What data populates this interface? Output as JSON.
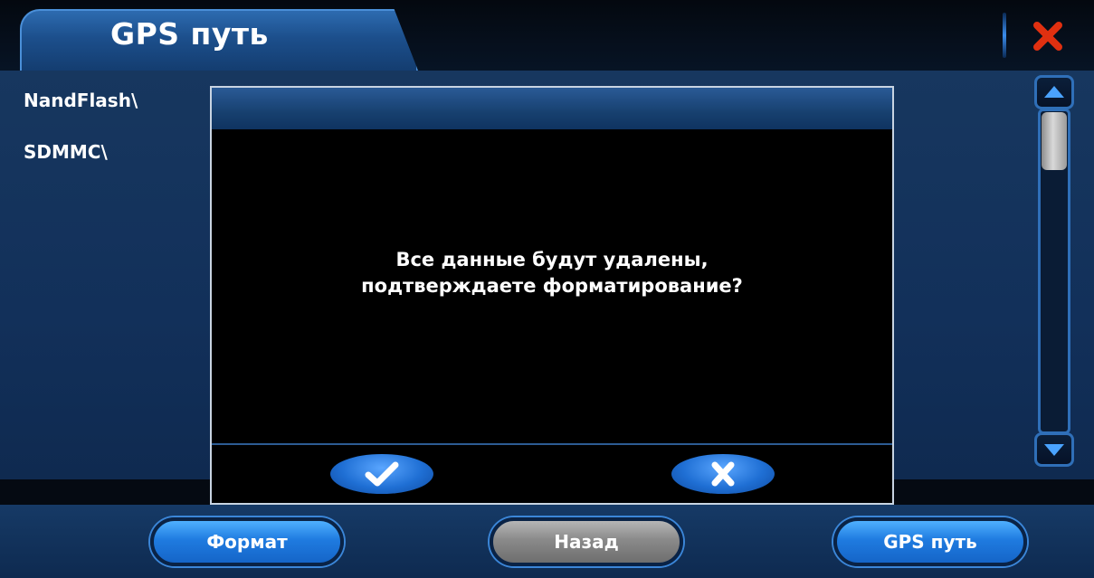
{
  "header": {
    "title": "GPS путь",
    "close_icon": "close-icon",
    "close_color": "#e03010"
  },
  "storage_list": {
    "items": [
      {
        "label": "NandFlash\\"
      },
      {
        "label": "SDMMC\\"
      }
    ]
  },
  "scrollbar": {
    "up_icon": "triangle-up-icon",
    "down_icon": "triangle-down-icon"
  },
  "dialog": {
    "message_line1": "Все данные будут удалены,",
    "message_line2": "подтверждаете форматирование?",
    "confirm_icon": "checkmark-icon",
    "cancel_icon": "x-icon"
  },
  "bottom_bar": {
    "format_label": "Формат",
    "back_label": "Назад",
    "gps_path_label": "GPS путь"
  },
  "colors": {
    "accent_blue": "#1f7be0",
    "panel_blue": "#12305a",
    "close_red": "#e03010"
  }
}
